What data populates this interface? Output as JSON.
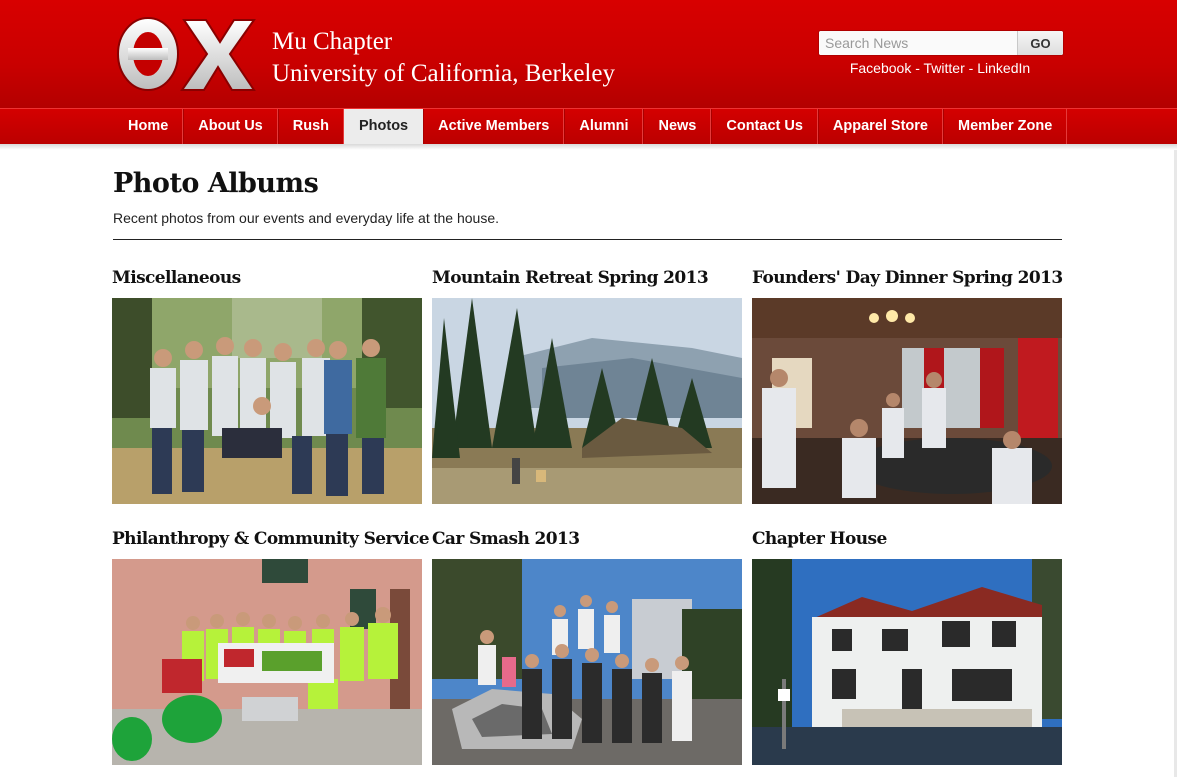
{
  "brand": {
    "logo_letters": "ΘΧ",
    "chapter_line": "Mu Chapter",
    "university_line": "University of California, Berkeley",
    "color_primary": "#cc0000"
  },
  "search": {
    "placeholder": "Search News",
    "button_label": "GO"
  },
  "social": {
    "facebook": "Facebook",
    "separator": "-",
    "twitter": "Twitter",
    "linkedin": "LinkedIn"
  },
  "nav": {
    "items": [
      {
        "label": "Home"
      },
      {
        "label": "About Us"
      },
      {
        "label": "Rush"
      },
      {
        "label": "Photos",
        "active": true
      },
      {
        "label": "Active Members"
      },
      {
        "label": "Alumni"
      },
      {
        "label": "News"
      },
      {
        "label": "Contact Us"
      },
      {
        "label": "Apparel Store"
      },
      {
        "label": "Member Zone"
      }
    ]
  },
  "main": {
    "title": "Photo Albums",
    "subtitle": "Recent photos from our events and everyday life at the house."
  },
  "albums": [
    {
      "title": "Miscellaneous",
      "photo": "group-hiking-photo"
    },
    {
      "title": "Mountain Retreat Spring 2013",
      "photo": "mountain-forest-photo"
    },
    {
      "title": "Founders' Day Dinner Spring 2013",
      "photo": "dinner-hall-photo"
    },
    {
      "title": "Philanthropy & Community Service",
      "photo": "volunteer-group-photo"
    },
    {
      "title": "Car Smash 2013",
      "photo": "car-smash-photo"
    },
    {
      "title": "Chapter House",
      "photo": "chapter-house-photo"
    }
  ]
}
